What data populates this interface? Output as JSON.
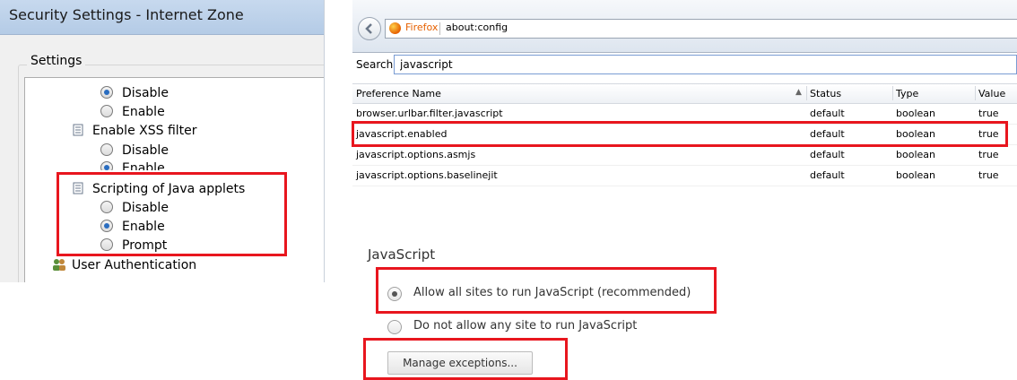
{
  "ie": {
    "title": "Security Settings - Internet Zone",
    "group_label": "Settings",
    "items": {
      "disable_1": "Disable",
      "enable_1": "Enable",
      "xss_filter": "Enable XSS filter",
      "xss_disable": "Disable",
      "xss_enable": "Enable",
      "java_applets": "Scripting of Java applets",
      "java_disable": "Disable",
      "java_enable": "Enable",
      "java_prompt": "Prompt",
      "user_auth": "User Authentication"
    }
  },
  "firefox": {
    "brand": "Firefox",
    "url": "about:config",
    "search_label": "Search:",
    "search_value": "javascript",
    "columns": [
      "Preference Name",
      "Status",
      "Type",
      "Value"
    ],
    "rows": [
      [
        "browser.urlbar.filter.javascript",
        "default",
        "boolean",
        "true"
      ],
      [
        "javascript.enabled",
        "default",
        "boolean",
        "true"
      ],
      [
        "javascript.options.asmjs",
        "default",
        "boolean",
        "true"
      ],
      [
        "javascript.options.baselinejit",
        "default",
        "boolean",
        "true"
      ]
    ]
  },
  "chrome": {
    "heading": "JavaScript",
    "allow_label": "Allow all sites to run JavaScript (recommended)",
    "deny_label": "Do not allow any site to run JavaScript",
    "manage_button": "Manage exceptions..."
  },
  "colors": {
    "highlight": "#e8161e",
    "firefox_orange": "#e66000"
  }
}
